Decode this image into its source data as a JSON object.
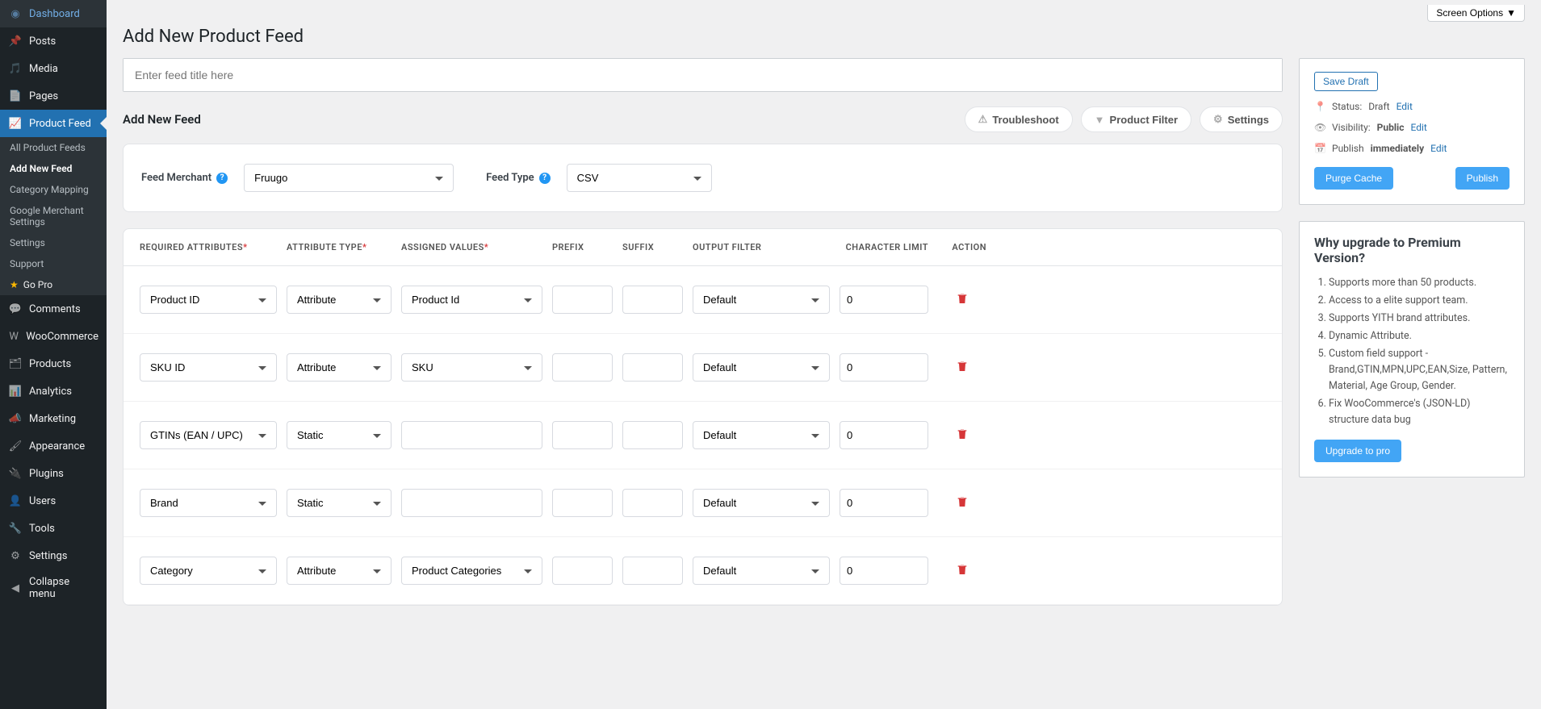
{
  "topbar": {
    "screen_options": "Screen Options"
  },
  "sidebar": {
    "items": [
      {
        "label": "Dashboard",
        "icon": "dashboard"
      },
      {
        "label": "Posts",
        "icon": "pin"
      },
      {
        "label": "Media",
        "icon": "media"
      },
      {
        "label": "Pages",
        "icon": "pages"
      },
      {
        "label": "Product Feed",
        "icon": "chart",
        "active": true
      },
      {
        "label": "Comments",
        "icon": "comment"
      },
      {
        "label": "WooCommerce",
        "icon": "woo"
      },
      {
        "label": "Products",
        "icon": "products"
      },
      {
        "label": "Analytics",
        "icon": "analytics"
      },
      {
        "label": "Marketing",
        "icon": "marketing"
      },
      {
        "label": "Appearance",
        "icon": "brush"
      },
      {
        "label": "Plugins",
        "icon": "plugin"
      },
      {
        "label": "Users",
        "icon": "user"
      },
      {
        "label": "Tools",
        "icon": "wrench"
      },
      {
        "label": "Settings",
        "icon": "settings"
      },
      {
        "label": "Collapse menu",
        "icon": "collapse"
      }
    ],
    "sub": [
      {
        "label": "All Product Feeds"
      },
      {
        "label": "Add New Feed",
        "active": true
      },
      {
        "label": "Category Mapping"
      },
      {
        "label": "Google Merchant Settings"
      },
      {
        "label": "Settings"
      },
      {
        "label": "Support"
      },
      {
        "label": "Go Pro",
        "gopro": true
      }
    ]
  },
  "page": {
    "title": "Add New Product Feed",
    "title_placeholder": "Enter feed title here",
    "panel_title": "Add New Feed",
    "actions": {
      "troubleshoot": "Troubleshoot",
      "filter": "Product Filter",
      "settings": "Settings"
    },
    "feed_merchant_label": "Feed Merchant",
    "feed_merchant_value": "Fruugo",
    "feed_type_label": "Feed Type",
    "feed_type_value": "CSV"
  },
  "table": {
    "headers": {
      "required": "REQUIRED ATTRIBUTES",
      "type": "ATTRIBUTE TYPE",
      "assigned": "ASSIGNED VALUES",
      "prefix": "PREFIX",
      "suffix": "SUFFIX",
      "output": "OUTPUT FILTER",
      "limit": "CHARACTER LIMIT",
      "action": "ACTION"
    },
    "rows": [
      {
        "attr": "Product ID",
        "type": "Attribute",
        "assigned": "Product Id",
        "output": "Default",
        "limit": "0"
      },
      {
        "attr": "SKU ID",
        "type": "Attribute",
        "assigned": "SKU",
        "output": "Default",
        "limit": "0"
      },
      {
        "attr": "GTINs (EAN / UPC)",
        "type": "Static",
        "assigned": "",
        "output": "Default",
        "limit": "0"
      },
      {
        "attr": "Brand",
        "type": "Static",
        "assigned": "",
        "output": "Default",
        "limit": "0"
      },
      {
        "attr": "Category",
        "type": "Attribute",
        "assigned": "Product Categories",
        "output": "Default",
        "limit": "0"
      }
    ]
  },
  "publish": {
    "save_draft": "Save Draft",
    "status_label": "Status:",
    "status_value": "Draft",
    "visibility_label": "Visibility:",
    "visibility_value": "Public",
    "publish_label": "Publish",
    "publish_value": "immediately",
    "edit": "Edit",
    "purge": "Purge Cache",
    "publish_btn": "Publish"
  },
  "premium": {
    "title": "Why upgrade to Premium Version?",
    "items": [
      "Supports more than 50 products.",
      "Access to a elite support team.",
      "Supports YITH brand attributes.",
      "Dynamic Attribute.",
      "Custom field support - Brand,GTIN,MPN,UPC,EAN,Size, Pattern, Material, Age Group, Gender.",
      "Fix WooCommerce's (JSON-LD) structure data bug"
    ],
    "upgrade": "Upgrade to pro"
  }
}
